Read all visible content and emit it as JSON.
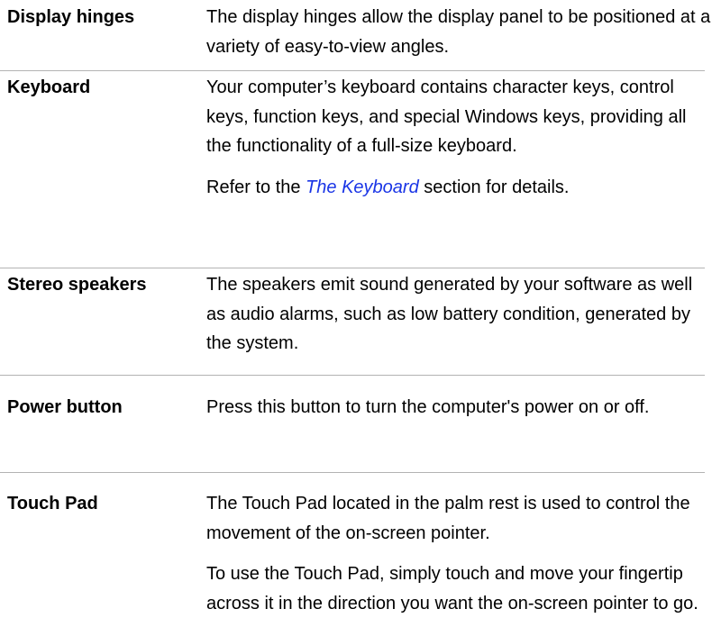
{
  "rows": [
    {
      "term": "Display hinges",
      "paragraphs": [
        "The display hinges allow the display panel to be positioned at a variety of easy-to-view angles."
      ]
    },
    {
      "term": "Keyboard",
      "paragraphs": [
        "Your computer’s keyboard contains character keys, control keys, function keys, and special Windows keys, providing all the functionality of a full-size keyboard."
      ],
      "ref": {
        "before": "Refer to the ",
        "link": "The Keyboard",
        "after": " section for details."
      }
    },
    {
      "term": "Stereo speakers",
      "paragraphs": [
        "The speakers emit sound generated by your software as well as audio alarms, such as low battery condition, generated by the system."
      ]
    },
    {
      "term": "Power button",
      "paragraphs": [
        "Press this button to turn the computer's power on or off."
      ]
    },
    {
      "term": "Touch Pad",
      "paragraphs": [
        "The Touch Pad located in the palm rest is used to control the movement of the on-screen pointer.",
        "To use the Touch Pad, simply touch and move your fingertip across it in the direction you want the on-screen pointer to go."
      ]
    }
  ],
  "colors": {
    "text": "#000000",
    "link": "#1a35e6",
    "separator": "#b3b3b3"
  }
}
